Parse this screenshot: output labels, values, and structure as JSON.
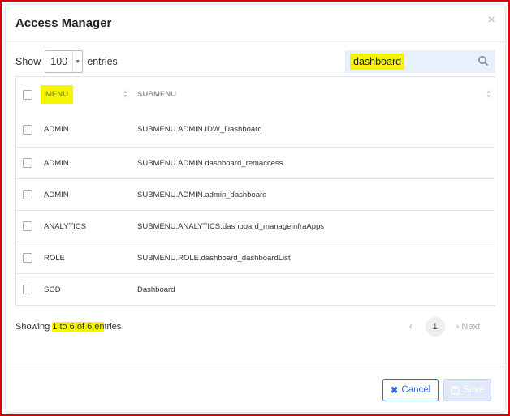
{
  "modal": {
    "title": "Access Manager",
    "close": "×"
  },
  "length": {
    "show": "Show",
    "value": "100",
    "entries": "entries"
  },
  "search": {
    "value": "dashboard",
    "icon": "search-icon"
  },
  "table": {
    "headers": [
      "MENU",
      "SUBMENU"
    ],
    "rows": [
      [
        "ADMIN",
        "SUBMENU.ADMIN.IDW_Dashboard"
      ],
      [
        "ADMIN",
        "SUBMENU.ADMIN.dashboard_remaccess"
      ],
      [
        "ADMIN",
        "SUBMENU.ADMIN.admin_dashboard"
      ],
      [
        "ANALYTICS",
        "SUBMENU.ANALYTICS.dashboard_manageInfraApps"
      ],
      [
        "ROLE",
        "SUBMENU.ROLE.dashboard_dashboardList"
      ],
      [
        "SOD",
        "Dashboard"
      ]
    ]
  },
  "info": {
    "prefix": "Showing ",
    "highlight": "1 to 6 of 6 en",
    "suffix": "tries"
  },
  "pager": {
    "prev": "‹",
    "page": "1",
    "next": "› Next"
  },
  "footer": {
    "cancel": "Cancel",
    "save": "Save"
  },
  "colors": {
    "accent": "#2f6be0",
    "highlight": "#f5f500"
  }
}
